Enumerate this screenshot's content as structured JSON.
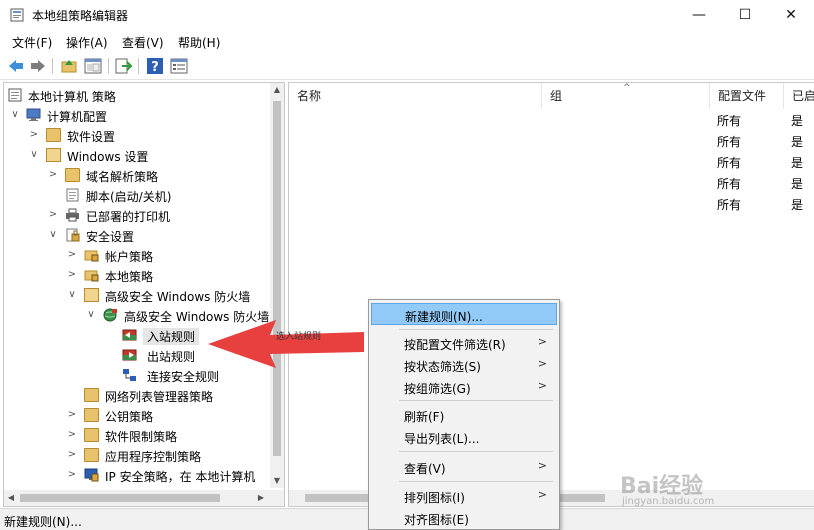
{
  "window": {
    "title": "本地组策略编辑器",
    "minimize": "—",
    "maximize": "☐",
    "close": "✕"
  },
  "menu": [
    "文件(F)",
    "操作(A)",
    "查看(V)",
    "帮助(H)"
  ],
  "toolbar": {
    "icons": [
      "back-icon",
      "forward-icon",
      "up-folder-icon",
      "show-hide-tree-icon",
      "export-list-icon",
      "help-icon",
      "properties-icon"
    ]
  },
  "tree": {
    "items": [
      {
        "label": "本地计算机 策略",
        "level": 0,
        "expanded": true
      },
      {
        "label": "计算机配置",
        "level": 1,
        "expanded": true
      },
      {
        "label": "软件设置",
        "level": 2,
        "expanded": false
      },
      {
        "label": "Windows 设置",
        "level": 2,
        "expanded": true
      },
      {
        "label": "域名解析策略",
        "level": 3,
        "expanded": false
      },
      {
        "label": "脚本(启动/关机)",
        "level": 3,
        "expanded": null
      },
      {
        "label": "已部署的打印机",
        "level": 3,
        "expanded": false
      },
      {
        "label": "安全设置",
        "level": 3,
        "expanded": true
      },
      {
        "label": "帐户策略",
        "level": 4,
        "expanded": false
      },
      {
        "label": "本地策略",
        "level": 4,
        "expanded": false
      },
      {
        "label": "高级安全 Windows 防火墙",
        "level": 4,
        "expanded": true
      },
      {
        "label": "高级安全 Windows 防火墙",
        "level": 5,
        "expanded": true
      },
      {
        "label": "入站规则",
        "level": 6,
        "expanded": null,
        "selected": true
      },
      {
        "label": "出站规则",
        "level": 6,
        "expanded": null
      },
      {
        "label": "连接安全规则",
        "level": 6,
        "expanded": null
      },
      {
        "label": "网络列表管理器策略",
        "level": 4,
        "expanded": null
      },
      {
        "label": "公钥策略",
        "level": 4,
        "expanded": false
      },
      {
        "label": "软件限制策略",
        "level": 4,
        "expanded": false
      },
      {
        "label": "应用程序控制策略",
        "level": 4,
        "expanded": false
      },
      {
        "label": "IP 安全策略，在 本地计算机",
        "level": 4,
        "expanded": false
      }
    ]
  },
  "list": {
    "columns": [
      "名称",
      "组",
      "配置文件",
      "已启"
    ],
    "rows": [
      {
        "profile": "所有",
        "enabled": "是"
      },
      {
        "profile": "所有",
        "enabled": "是"
      },
      {
        "profile": "所有",
        "enabled": "是"
      },
      {
        "profile": "所有",
        "enabled": "是"
      },
      {
        "profile": "所有",
        "enabled": "是"
      }
    ]
  },
  "context_menu": {
    "items": [
      {
        "label": "新建规则(N)...",
        "submenu": false,
        "highlighted": true
      },
      {
        "separator": true
      },
      {
        "label": "按配置文件筛选(R)",
        "submenu": true
      },
      {
        "label": "按状态筛选(S)",
        "submenu": true
      },
      {
        "label": "按组筛选(G)",
        "submenu": true
      },
      {
        "separator": true
      },
      {
        "label": "刷新(F)",
        "submenu": false
      },
      {
        "label": "导出列表(L)...",
        "submenu": false
      },
      {
        "separator": true
      },
      {
        "label": "查看(V)",
        "submenu": true
      },
      {
        "separator": true
      },
      {
        "label": "排列图标(I)",
        "submenu": true
      },
      {
        "label": "对齐图标(E)",
        "submenu": false
      }
    ]
  },
  "annotation": {
    "text": "选入站规则",
    "color": "#e8403f"
  },
  "status": "新建规则(N)...",
  "watermark": {
    "main": "Bai经验",
    "sub": "jingyan.baidu.com"
  }
}
